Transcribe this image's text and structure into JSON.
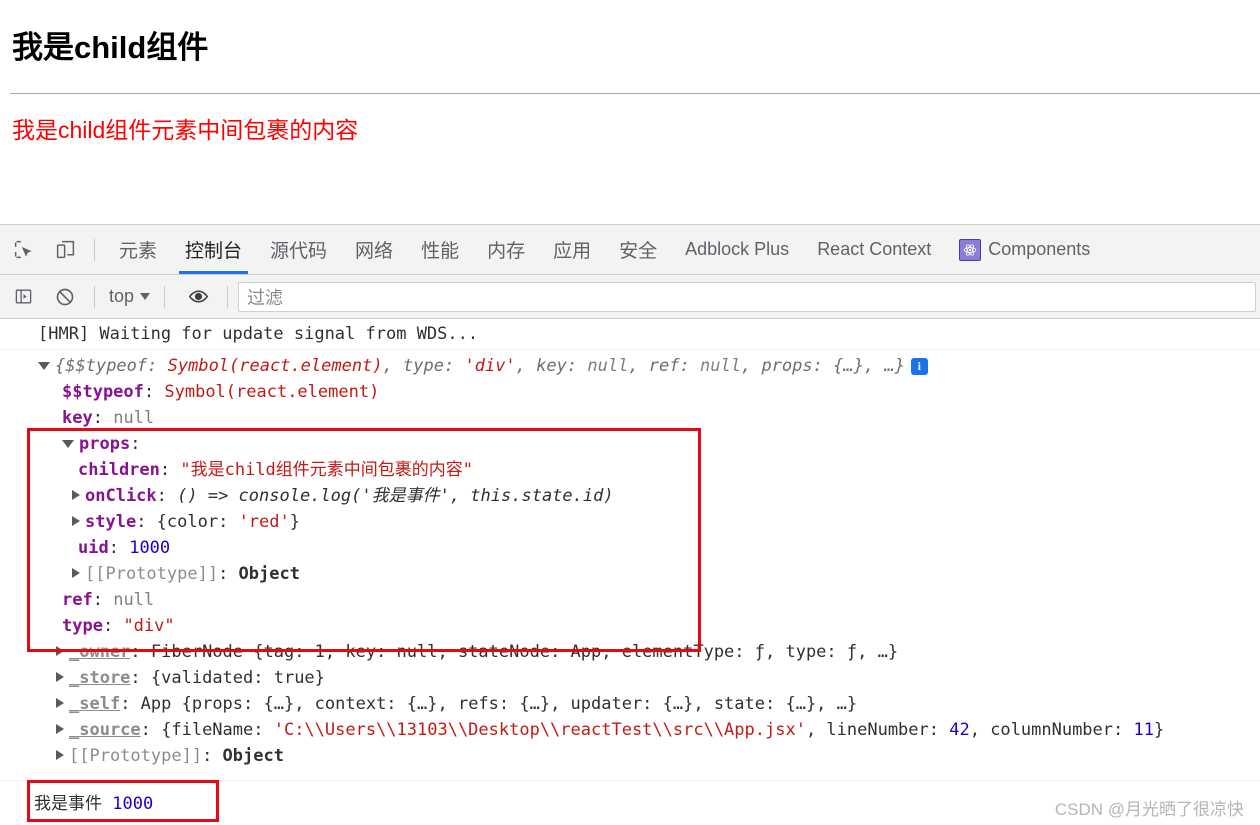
{
  "page": {
    "heading": "我是child组件",
    "red_text": "我是child组件元素中间包裹的内容",
    "red_color": "#ff0000"
  },
  "devtools": {
    "accent_color": "#1a73e8",
    "toolbar_icons": [
      {
        "name": "inspect-element-icon",
        "glyph": "inspect"
      },
      {
        "name": "device-toolbar-icon",
        "glyph": "device"
      }
    ],
    "tabs": [
      {
        "label": "元素",
        "active": false
      },
      {
        "label": "控制台",
        "active": true
      },
      {
        "label": "源代码",
        "active": false
      },
      {
        "label": "网络",
        "active": false
      },
      {
        "label": "性能",
        "active": false
      },
      {
        "label": "内存",
        "active": false
      },
      {
        "label": "应用",
        "active": false
      },
      {
        "label": "安全",
        "active": false
      },
      {
        "label": "Adblock Plus",
        "active": false
      },
      {
        "label": "React Context",
        "active": false
      },
      {
        "label": "Components",
        "active": false,
        "icon": "react-atom-icon"
      }
    ],
    "filterbar": {
      "sidebar_toggle_icon": "sidebar-toggle-icon",
      "clear_console_icon": "clear-console-icon",
      "context_label": "top",
      "eye_icon": "live-expression-eye-icon",
      "filter_placeholder": "过滤",
      "filter_value": ""
    }
  },
  "console": {
    "hmr_message": "[HMR] Waiting for update signal from WDS...",
    "object_summary": {
      "typeof_key": "$$typeof",
      "typeof_value": "Symbol(react.element)",
      "type_key": "type",
      "type_value": "'div'",
      "key_key": "key",
      "key_value": "null",
      "ref_key": "ref",
      "ref_value": "null",
      "props_key": "props",
      "props_value": "{…}",
      "ellipsis": "…",
      "info_badge": "i"
    },
    "rows": {
      "typeof_label": "$$typeof",
      "typeof_val": "Symbol(react.element)",
      "key_label": "key",
      "key_val": "null",
      "props_label": "props",
      "children_label": "children",
      "children_val": "\"我是child组件元素中间包裹的内容\"",
      "onclick_label": "onClick",
      "onclick_val": "() => console.log('我是事件', this.state.id)",
      "style_label": "style",
      "style_val_open": "{color: ",
      "style_val_str": "'red'",
      "style_val_close": "}",
      "uid_label": "uid",
      "uid_val": "1000",
      "proto_label": "[[Prototype]]",
      "proto_val": "Object",
      "ref_label": "ref",
      "ref_val": "null",
      "type_label": "type",
      "type_val": "\"div\"",
      "owner_label": "_owner",
      "owner_val": "FiberNode {tag: 1, key: null, stateNode: App, elementType: ƒ, type: ƒ, …}",
      "store_label": "_store",
      "store_val": "{validated: true}",
      "self_label": "_self",
      "self_val": "App {props: {…}, context: {…}, refs: {…}, updater: {…}, state: {…}, …}",
      "source_label": "_source",
      "source_filename": "'C:\\\\Users\\\\13103\\\\Desktop\\\\reactTest\\\\src\\\\App.jsx'",
      "source_linenumber": "42",
      "source_columnnumber": "11",
      "proto2_label": "[[Prototype]]",
      "proto2_val": "Object"
    },
    "event_log": {
      "text": "我是事件",
      "value": "1000"
    }
  },
  "annotations": {
    "box_color": "#e50914",
    "props_box_name": "props-highlight-box",
    "event_box_name": "event-log-highlight-box"
  },
  "watermark": "CSDN @月光晒了很凉快"
}
